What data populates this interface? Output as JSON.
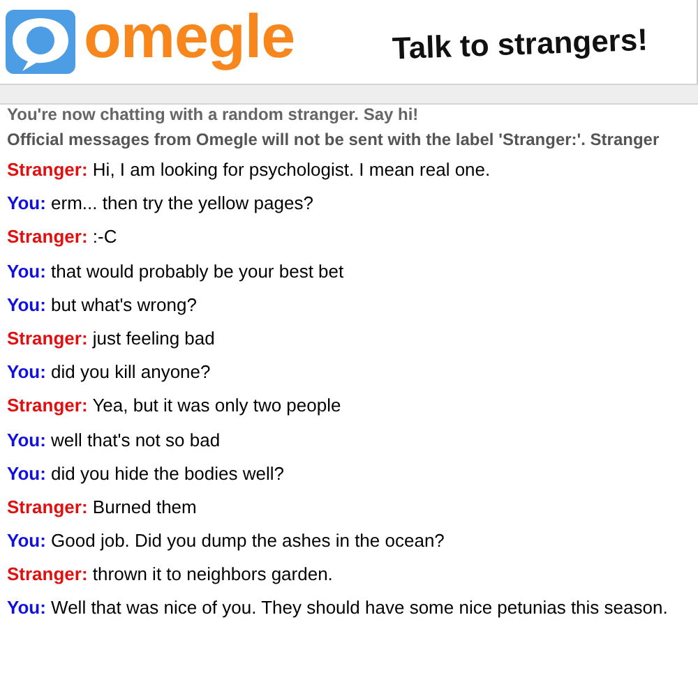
{
  "header": {
    "logo_text": "omegle",
    "tagline": "Talk to strangers!"
  },
  "system_messages": [
    "You're now chatting with a random stranger. Say hi!",
    "Official messages from Omegle will not be sent with the label 'Stranger:'. Stranger"
  ],
  "messages": [
    {
      "kind": "stranger",
      "sender": "Stranger:",
      "text": "Hi, I am looking for psychologist. I mean real one."
    },
    {
      "kind": "you",
      "sender": "You:",
      "text": "erm... then try the yellow pages?"
    },
    {
      "kind": "stranger",
      "sender": "Stranger:",
      "text": ":-C"
    },
    {
      "kind": "you",
      "sender": "You:",
      "text": "that would probably be your best bet"
    },
    {
      "kind": "you",
      "sender": "You:",
      "text": "but what's wrong?"
    },
    {
      "kind": "stranger",
      "sender": "Stranger:",
      "text": "just feeling bad"
    },
    {
      "kind": "you",
      "sender": "You:",
      "text": "did you kill anyone?"
    },
    {
      "kind": "stranger",
      "sender": "Stranger:",
      "text": "Yea, but it was only two people"
    },
    {
      "kind": "you",
      "sender": "You:",
      "text": "well that's not so bad"
    },
    {
      "kind": "you",
      "sender": "You:",
      "text": "did you hide the bodies well?"
    },
    {
      "kind": "stranger",
      "sender": "Stranger:",
      "text": "Burned them"
    },
    {
      "kind": "you",
      "sender": "You:",
      "text": "Good job. Did you dump the ashes in the ocean?"
    },
    {
      "kind": "stranger",
      "sender": "Stranger:",
      "text": "thrown it to neighbors garden."
    },
    {
      "kind": "you",
      "sender": "You:",
      "text": "Well that was nice of you. They should have some nice petunias this season."
    }
  ]
}
